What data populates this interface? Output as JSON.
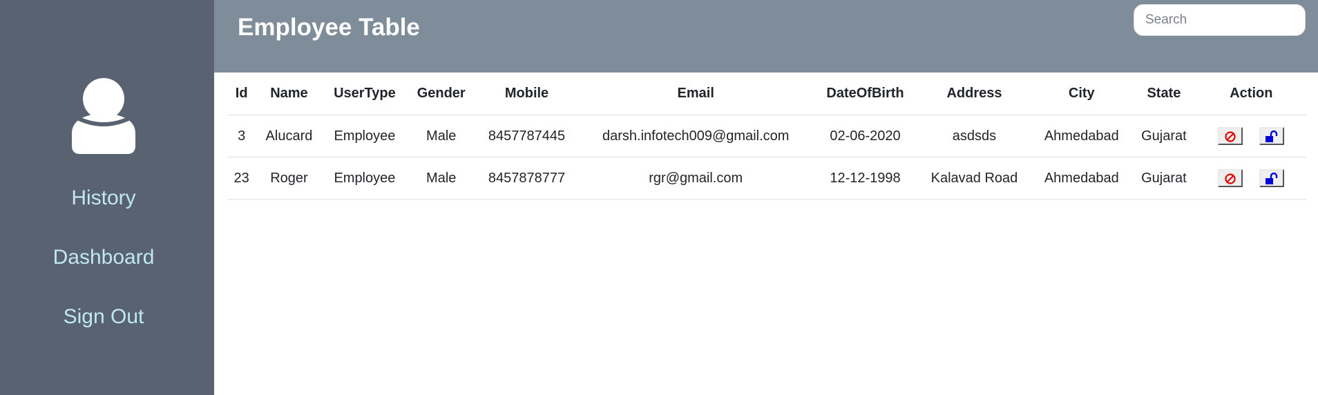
{
  "sidebar": {
    "avatar_icon": "user-icon",
    "items": [
      {
        "label": "History"
      },
      {
        "label": "Dashboard"
      },
      {
        "label": "Sign Out"
      }
    ],
    "text_color": "#bfe8f2",
    "background": "#596270"
  },
  "header": {
    "title": "Employee Table",
    "background": "#7f8c99",
    "search": {
      "placeholder": "Search",
      "value": ""
    }
  },
  "table": {
    "columns": [
      "Id",
      "Name",
      "UserType",
      "Gender",
      "Mobile",
      "Email",
      "DateOfBirth",
      "Address",
      "City",
      "State",
      "Action"
    ],
    "rows": [
      {
        "id": "3",
        "name": "Alucard",
        "usertype": "Employee",
        "gender": "Male",
        "mobile": "8457787445",
        "email": "darsh.infotech009@gmail.com",
        "dob": "02-06-2020",
        "address": "asdsds",
        "city": "Ahmedabad",
        "state": "Gujarat"
      },
      {
        "id": "23",
        "name": "Roger",
        "usertype": "Employee",
        "gender": "Male",
        "mobile": "8457878777",
        "email": "rgr@gmail.com",
        "dob": "12-12-1998",
        "address": "Kalavad Road",
        "city": "Ahmedabad",
        "state": "Gujarat"
      }
    ],
    "action_icons": [
      "block-icon",
      "unlock-icon"
    ]
  }
}
